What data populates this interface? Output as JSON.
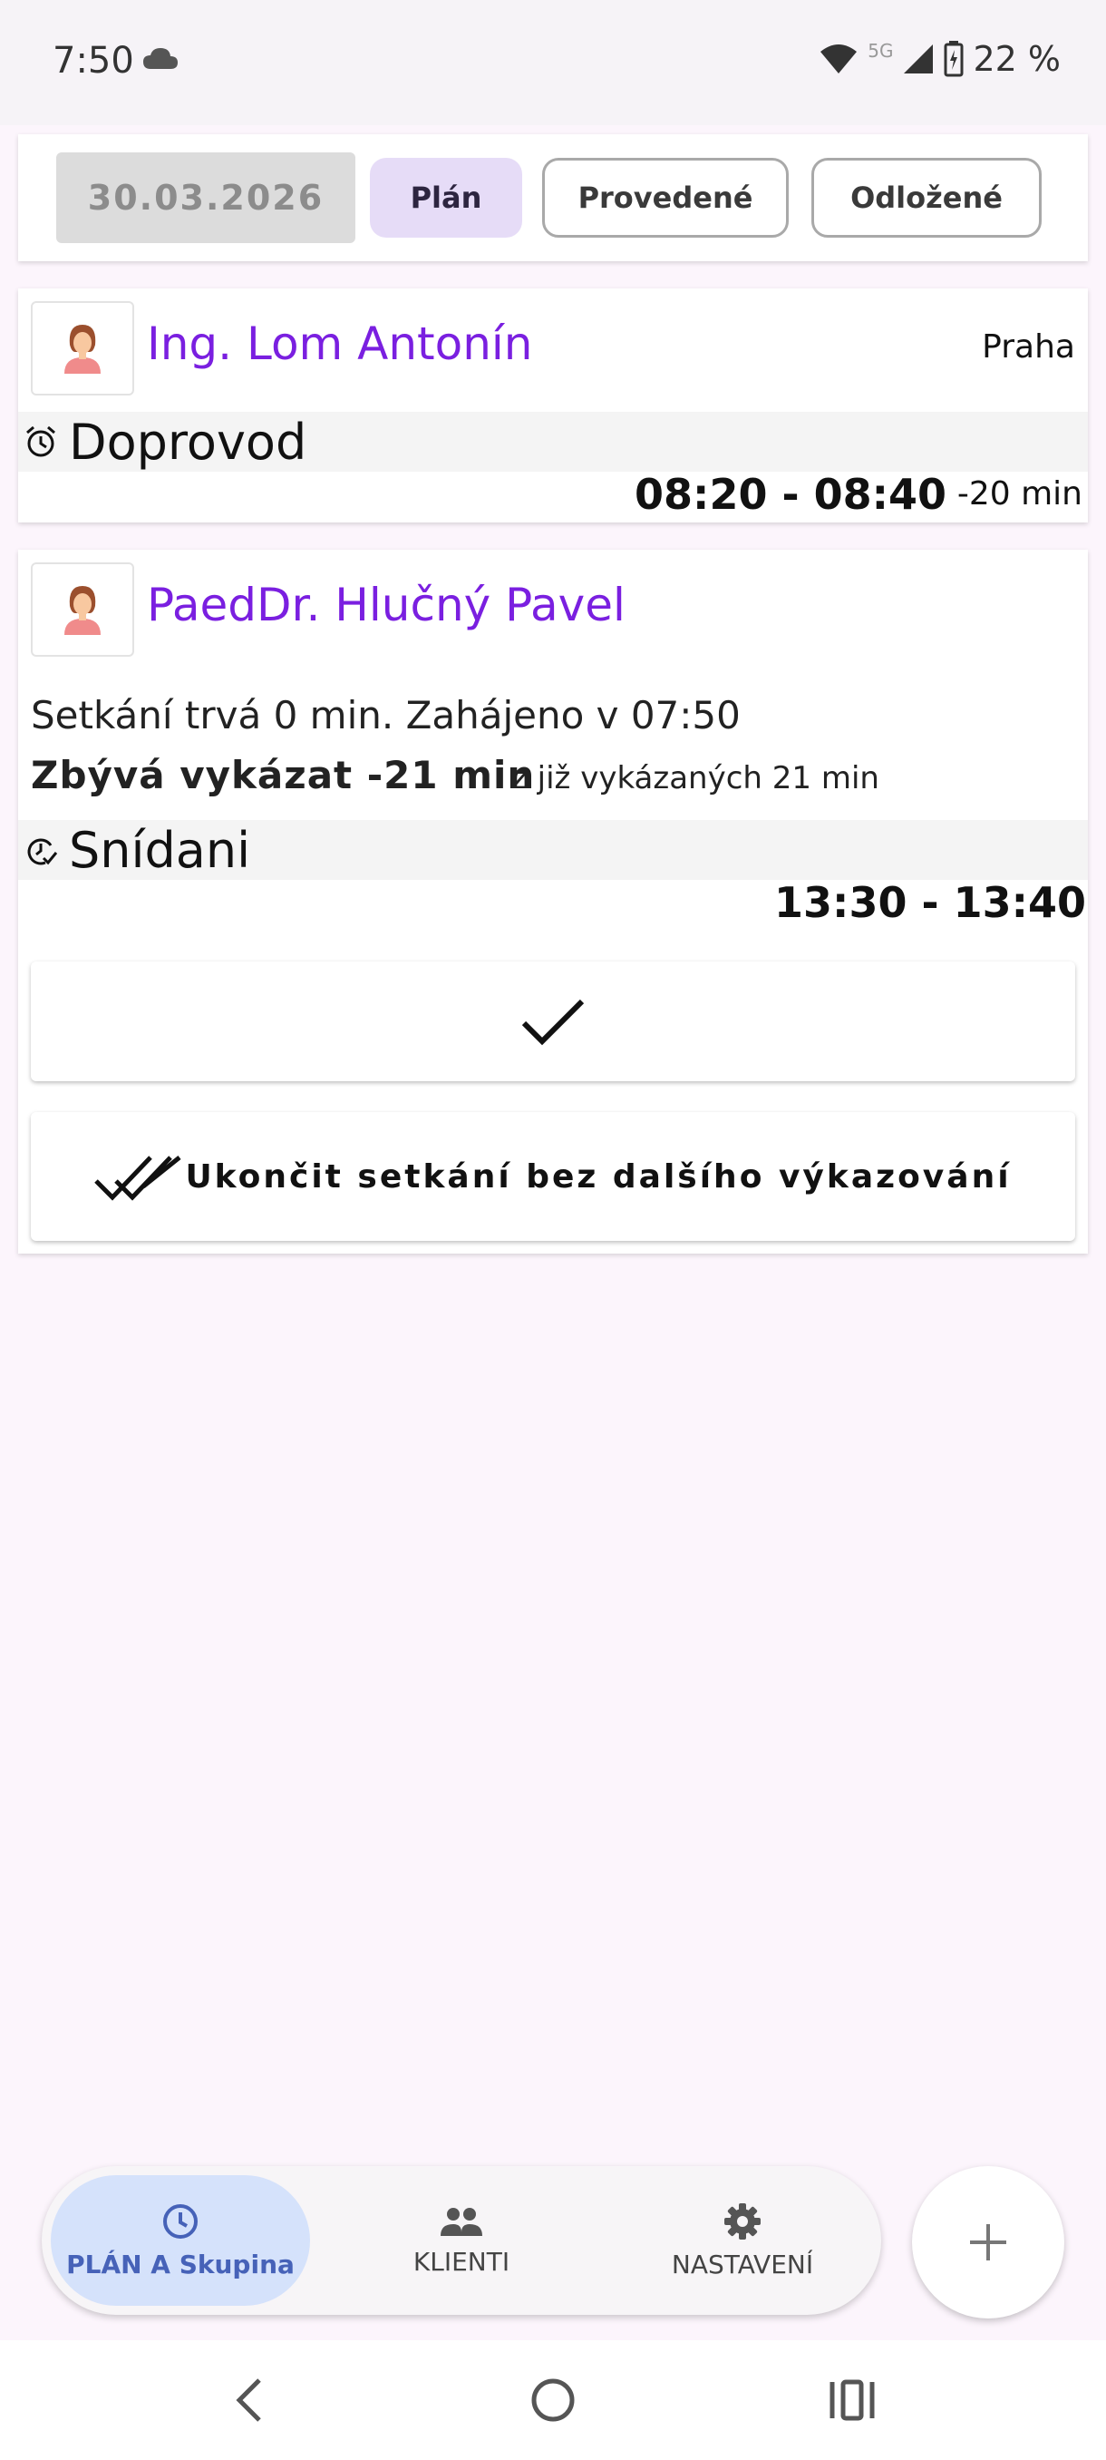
{
  "status_bar": {
    "time": "7:50",
    "network": "5G",
    "battery": "22 %"
  },
  "filter": {
    "date": "30.03.2026",
    "tabs": [
      "Plán",
      "Provedené",
      "Odložené"
    ],
    "active_tab": "Plán"
  },
  "visits": [
    {
      "client": "Ing. Lom Antonín",
      "city": "Praha",
      "activity_icon": "alarm-icon",
      "activity": "Doprovod",
      "time_range": "08:20 - 08:40",
      "delay": "-20 min"
    },
    {
      "client": "PaedDr. Hlučný Pavel",
      "meeting_info": "Setkání trvá 0 min. Zahájeno v 07:50",
      "remaining": "Zbývá vykázat -21 min",
      "reported": "z již vykázaných 21 min",
      "activity_icon": "check-clock-icon",
      "activity": "Snídani",
      "time_range": "13:30 - 13:40",
      "confirm_icon": "check-icon",
      "finish_label": "Ukončit setkání bez dalšího výkazování"
    }
  ],
  "bottom_nav": [
    {
      "label": "PLÁN A Skupina",
      "icon": "clock-icon",
      "active": true
    },
    {
      "label": "KLIENTI",
      "icon": "people-icon",
      "active": false
    },
    {
      "label": "NASTAVENÍ",
      "icon": "gear-icon",
      "active": false
    }
  ],
  "fab_icon": "plus-icon",
  "colors": {
    "client_name": "#7a1fe0",
    "active_tab": "#e6dcf7",
    "active_nav": "#d5e2fb",
    "background": "#fcf5fc"
  }
}
